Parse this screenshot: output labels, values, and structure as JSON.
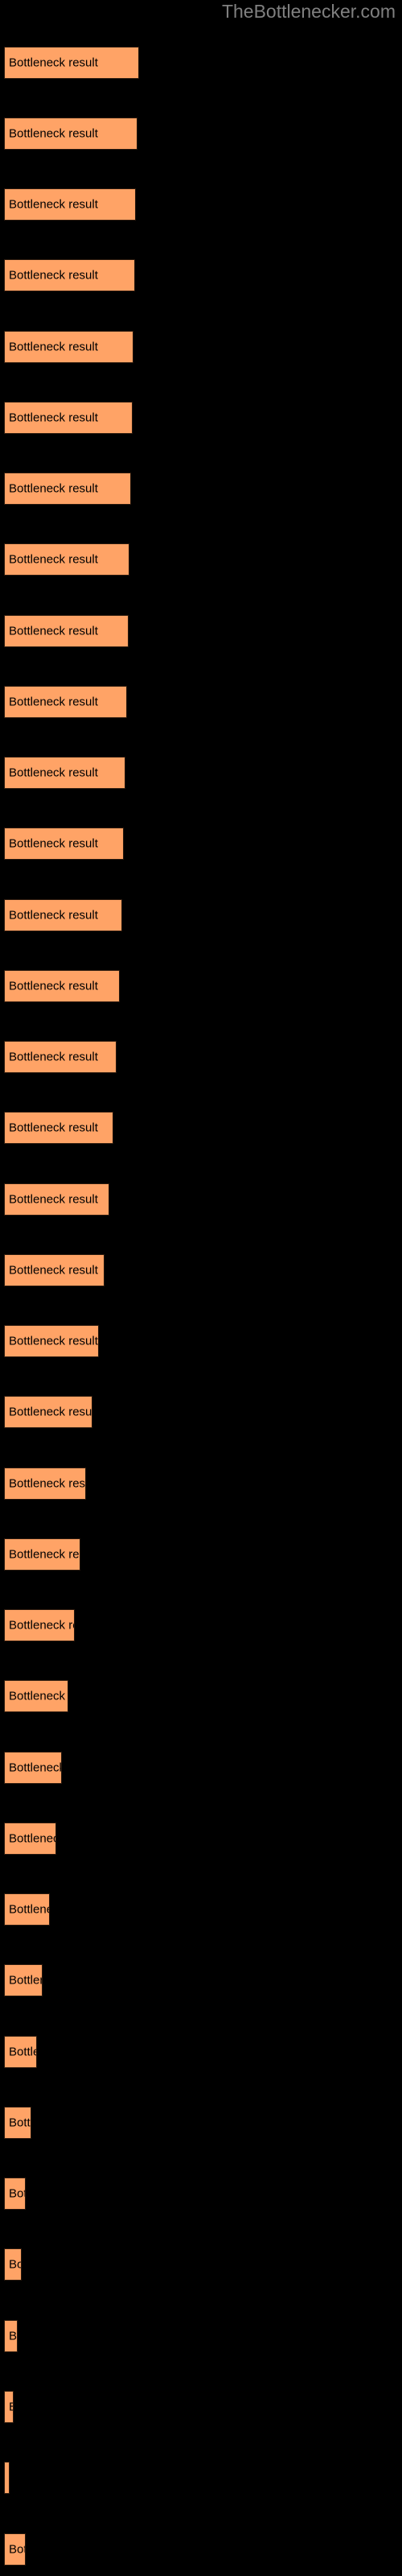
{
  "watermark": "TheBottlenecker.com",
  "colors": {
    "background": "#000000",
    "bar_fill": "#ffa366",
    "bar_border": "#2b1a0e",
    "bar_text": "#000000",
    "watermark_text": "#808080"
  },
  "chart_data": {
    "type": "bar",
    "orientation": "horizontal",
    "title": "",
    "subtitle": "",
    "xlabel": "",
    "ylabel": "",
    "grid": false,
    "legend": null,
    "bar_label": "Bottleneck result",
    "categories": [
      "Bottleneck result",
      "Bottleneck result",
      "Bottleneck result",
      "Bottleneck result",
      "Bottleneck result",
      "Bottleneck result",
      "Bottleneck result",
      "Bottleneck result",
      "Bottleneck result",
      "Bottleneck result",
      "Bottleneck result",
      "Bottleneck result",
      "Bottleneck result",
      "Bottleneck result",
      "Bottleneck result",
      "Bottleneck result",
      "Bottleneck result",
      "Bottleneck result",
      "Bottleneck result",
      "Bottleneck result",
      "Bottleneck result",
      "Bottleneck result",
      "Bottleneck result",
      "Bottleneck result",
      "Bottleneck result",
      "Bottleneck result",
      "Bottleneck result",
      "Bottleneck result",
      "Bottleneck result",
      "Bottleneck result",
      "Bottleneck result",
      "Bottleneck result",
      "Bottleneck result",
      "Bottleneck result",
      "Bottleneck result",
      "Bottleneck result"
    ],
    "values": [
      168,
      166,
      164,
      163,
      161,
      160,
      158,
      156,
      155,
      153,
      151,
      149,
      147,
      144,
      140,
      136,
      131,
      125,
      118,
      110,
      102,
      95,
      88,
      80,
      72,
      65,
      57,
      48,
      41,
      34,
      27,
      22,
      17,
      12,
      7,
      27
    ],
    "ylim": [
      0,
      36
    ],
    "xlim": [
      0,
      495
    ]
  },
  "bars": [
    {
      "label": "Bottleneck result",
      "width": 168,
      "top": 58
    },
    {
      "label": "Bottleneck result",
      "width": 166,
      "top": 146
    },
    {
      "label": "Bottleneck result",
      "width": 164,
      "top": 234
    },
    {
      "label": "Bottleneck result",
      "width": 163,
      "top": 322
    },
    {
      "label": "Bottleneck result",
      "width": 161,
      "top": 411
    },
    {
      "label": "Bottleneck result",
      "width": 160,
      "top": 499
    },
    {
      "label": "Bottleneck result",
      "width": 158,
      "top": 587
    },
    {
      "label": "Bottleneck result",
      "width": 156,
      "top": 675
    },
    {
      "label": "Bottleneck result",
      "width": 155,
      "top": 764
    },
    {
      "label": "Bottleneck result",
      "width": 153,
      "top": 852
    },
    {
      "label": "Bottleneck result",
      "width": 151,
      "top": 940
    },
    {
      "label": "Bottleneck result",
      "width": 149,
      "top": 1028
    },
    {
      "label": "Bottleneck result",
      "width": 147,
      "top": 1117
    },
    {
      "label": "Bottleneck result",
      "width": 144,
      "top": 1205
    },
    {
      "label": "Bottleneck result",
      "width": 140,
      "top": 1293
    },
    {
      "label": "Bottleneck result",
      "width": 136,
      "top": 1381
    },
    {
      "label": "Bottleneck result",
      "width": 131,
      "top": 1470
    },
    {
      "label": "Bottleneck result",
      "width": 125,
      "top": 1558
    },
    {
      "label": "Bottleneck result",
      "width": 118,
      "top": 1646
    },
    {
      "label": "Bottleneck result",
      "width": 110,
      "top": 1734
    },
    {
      "label": "Bottleneck result",
      "width": 102,
      "top": 1823
    },
    {
      "label": "Bottleneck result",
      "width": 95,
      "top": 1911
    },
    {
      "label": "Bottleneck result",
      "width": 88,
      "top": 1999
    },
    {
      "label": "Bottleneck result",
      "width": 80,
      "top": 2087
    },
    {
      "label": "Bottleneck result",
      "width": 72,
      "top": 2176
    },
    {
      "label": "Bottleneck result",
      "width": 65,
      "top": 2264
    },
    {
      "label": "Bottleneck result",
      "width": 57,
      "top": 2352
    },
    {
      "label": "Bottleneck result",
      "width": 48,
      "top": 2440
    },
    {
      "label": "Bottleneck result",
      "width": 41,
      "top": 2529
    },
    {
      "label": "Bottleneck result",
      "width": 34,
      "top": 2617
    },
    {
      "label": "Bottleneck result",
      "width": 27,
      "top": 2705
    },
    {
      "label": "Bottleneck result",
      "width": 22,
      "top": 2793
    },
    {
      "label": "Bottleneck result",
      "width": 17,
      "top": 2882
    },
    {
      "label": "Bottleneck result",
      "width": 12,
      "top": 2970
    },
    {
      "label": "Bottleneck result",
      "width": 7,
      "top": 3058
    },
    {
      "label": "Bottleneck result",
      "width": 27,
      "top": 3147
    }
  ]
}
